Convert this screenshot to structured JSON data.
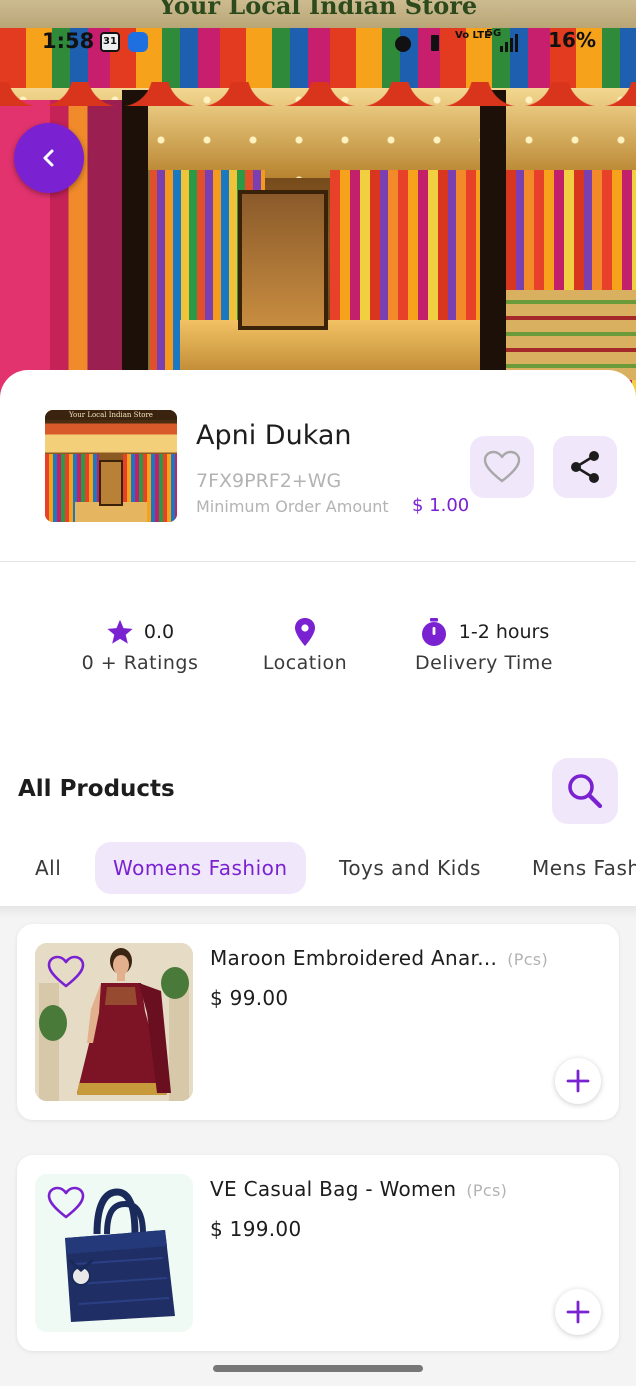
{
  "banner": {
    "sign_text": "Your Local Indian Store"
  },
  "status_bar": {
    "time": "1:58",
    "calendar_day": "31",
    "network": "5G",
    "volte": "Vo LTE",
    "battery": "16%"
  },
  "store": {
    "name": "Apni Dukan",
    "plus_code": "7FX9PRF2+WG",
    "min_order_label": "Minimum Order Amount",
    "min_order_value": "$ 1.00",
    "thumb_sign": "Your Local Indian Store"
  },
  "stats": {
    "rating_value": "0.0",
    "rating_label": "0 + Ratings",
    "location_label": "Location",
    "delivery_value": "1-2 hours",
    "delivery_label": "Delivery Time"
  },
  "products_section": {
    "title": "All Products"
  },
  "tabs": [
    {
      "label": "All",
      "active": false
    },
    {
      "label": "Womens Fashion",
      "active": true
    },
    {
      "label": "Toys and Kids",
      "active": false
    },
    {
      "label": "Mens Fash",
      "active": false
    }
  ],
  "products": [
    {
      "name": "Maroon Embroidered Anar...",
      "unit": "(Pcs)",
      "price": "$ 99.00"
    },
    {
      "name": "VE Casual Bag - Women",
      "unit": "(Pcs)",
      "price": "$ 199.00"
    }
  ],
  "colors": {
    "accent": "#7a22d2",
    "accent_light": "#f1e7fb",
    "muted_text": "#b3b3b3"
  },
  "icons": {
    "back": "chevron-left-icon",
    "favorite": "heart-outline-icon",
    "share": "share-icon",
    "rating": "star-icon",
    "location": "map-pin-icon",
    "delivery": "stopwatch-icon",
    "search": "search-icon",
    "add": "plus-icon"
  }
}
